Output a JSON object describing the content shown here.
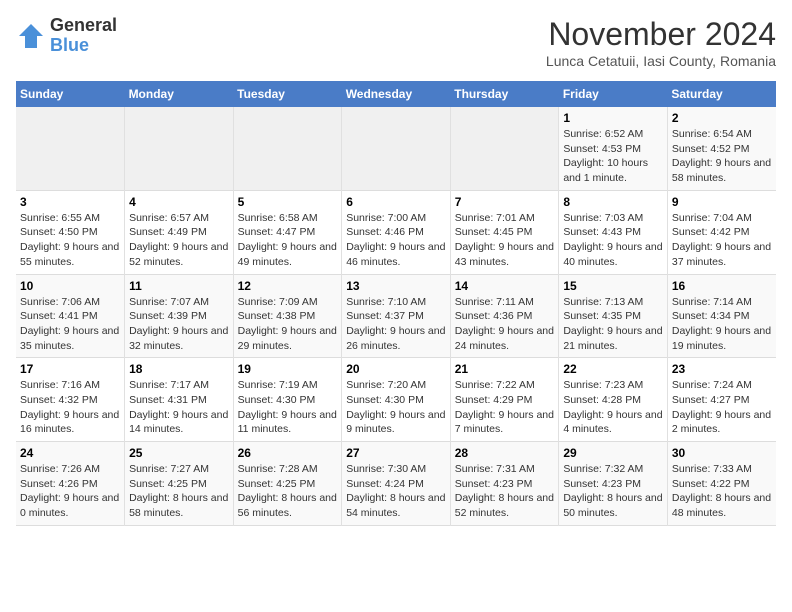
{
  "logo": {
    "general": "General",
    "blue": "Blue"
  },
  "title": "November 2024",
  "location": "Lunca Cetatuii, Iasi County, Romania",
  "headers": [
    "Sunday",
    "Monday",
    "Tuesday",
    "Wednesday",
    "Thursday",
    "Friday",
    "Saturday"
  ],
  "weeks": [
    [
      {
        "day": "",
        "info": ""
      },
      {
        "day": "",
        "info": ""
      },
      {
        "day": "",
        "info": ""
      },
      {
        "day": "",
        "info": ""
      },
      {
        "day": "",
        "info": ""
      },
      {
        "day": "1",
        "info": "Sunrise: 6:52 AM\nSunset: 4:53 PM\nDaylight: 10 hours and 1 minute."
      },
      {
        "day": "2",
        "info": "Sunrise: 6:54 AM\nSunset: 4:52 PM\nDaylight: 9 hours and 58 minutes."
      }
    ],
    [
      {
        "day": "3",
        "info": "Sunrise: 6:55 AM\nSunset: 4:50 PM\nDaylight: 9 hours and 55 minutes."
      },
      {
        "day": "4",
        "info": "Sunrise: 6:57 AM\nSunset: 4:49 PM\nDaylight: 9 hours and 52 minutes."
      },
      {
        "day": "5",
        "info": "Sunrise: 6:58 AM\nSunset: 4:47 PM\nDaylight: 9 hours and 49 minutes."
      },
      {
        "day": "6",
        "info": "Sunrise: 7:00 AM\nSunset: 4:46 PM\nDaylight: 9 hours and 46 minutes."
      },
      {
        "day": "7",
        "info": "Sunrise: 7:01 AM\nSunset: 4:45 PM\nDaylight: 9 hours and 43 minutes."
      },
      {
        "day": "8",
        "info": "Sunrise: 7:03 AM\nSunset: 4:43 PM\nDaylight: 9 hours and 40 minutes."
      },
      {
        "day": "9",
        "info": "Sunrise: 7:04 AM\nSunset: 4:42 PM\nDaylight: 9 hours and 37 minutes."
      }
    ],
    [
      {
        "day": "10",
        "info": "Sunrise: 7:06 AM\nSunset: 4:41 PM\nDaylight: 9 hours and 35 minutes."
      },
      {
        "day": "11",
        "info": "Sunrise: 7:07 AM\nSunset: 4:39 PM\nDaylight: 9 hours and 32 minutes."
      },
      {
        "day": "12",
        "info": "Sunrise: 7:09 AM\nSunset: 4:38 PM\nDaylight: 9 hours and 29 minutes."
      },
      {
        "day": "13",
        "info": "Sunrise: 7:10 AM\nSunset: 4:37 PM\nDaylight: 9 hours and 26 minutes."
      },
      {
        "day": "14",
        "info": "Sunrise: 7:11 AM\nSunset: 4:36 PM\nDaylight: 9 hours and 24 minutes."
      },
      {
        "day": "15",
        "info": "Sunrise: 7:13 AM\nSunset: 4:35 PM\nDaylight: 9 hours and 21 minutes."
      },
      {
        "day": "16",
        "info": "Sunrise: 7:14 AM\nSunset: 4:34 PM\nDaylight: 9 hours and 19 minutes."
      }
    ],
    [
      {
        "day": "17",
        "info": "Sunrise: 7:16 AM\nSunset: 4:32 PM\nDaylight: 9 hours and 16 minutes."
      },
      {
        "day": "18",
        "info": "Sunrise: 7:17 AM\nSunset: 4:31 PM\nDaylight: 9 hours and 14 minutes."
      },
      {
        "day": "19",
        "info": "Sunrise: 7:19 AM\nSunset: 4:30 PM\nDaylight: 9 hours and 11 minutes."
      },
      {
        "day": "20",
        "info": "Sunrise: 7:20 AM\nSunset: 4:30 PM\nDaylight: 9 hours and 9 minutes."
      },
      {
        "day": "21",
        "info": "Sunrise: 7:22 AM\nSunset: 4:29 PM\nDaylight: 9 hours and 7 minutes."
      },
      {
        "day": "22",
        "info": "Sunrise: 7:23 AM\nSunset: 4:28 PM\nDaylight: 9 hours and 4 minutes."
      },
      {
        "day": "23",
        "info": "Sunrise: 7:24 AM\nSunset: 4:27 PM\nDaylight: 9 hours and 2 minutes."
      }
    ],
    [
      {
        "day": "24",
        "info": "Sunrise: 7:26 AM\nSunset: 4:26 PM\nDaylight: 9 hours and 0 minutes."
      },
      {
        "day": "25",
        "info": "Sunrise: 7:27 AM\nSunset: 4:25 PM\nDaylight: 8 hours and 58 minutes."
      },
      {
        "day": "26",
        "info": "Sunrise: 7:28 AM\nSunset: 4:25 PM\nDaylight: 8 hours and 56 minutes."
      },
      {
        "day": "27",
        "info": "Sunrise: 7:30 AM\nSunset: 4:24 PM\nDaylight: 8 hours and 54 minutes."
      },
      {
        "day": "28",
        "info": "Sunrise: 7:31 AM\nSunset: 4:23 PM\nDaylight: 8 hours and 52 minutes."
      },
      {
        "day": "29",
        "info": "Sunrise: 7:32 AM\nSunset: 4:23 PM\nDaylight: 8 hours and 50 minutes."
      },
      {
        "day": "30",
        "info": "Sunrise: 7:33 AM\nSunset: 4:22 PM\nDaylight: 8 hours and 48 minutes."
      }
    ]
  ]
}
